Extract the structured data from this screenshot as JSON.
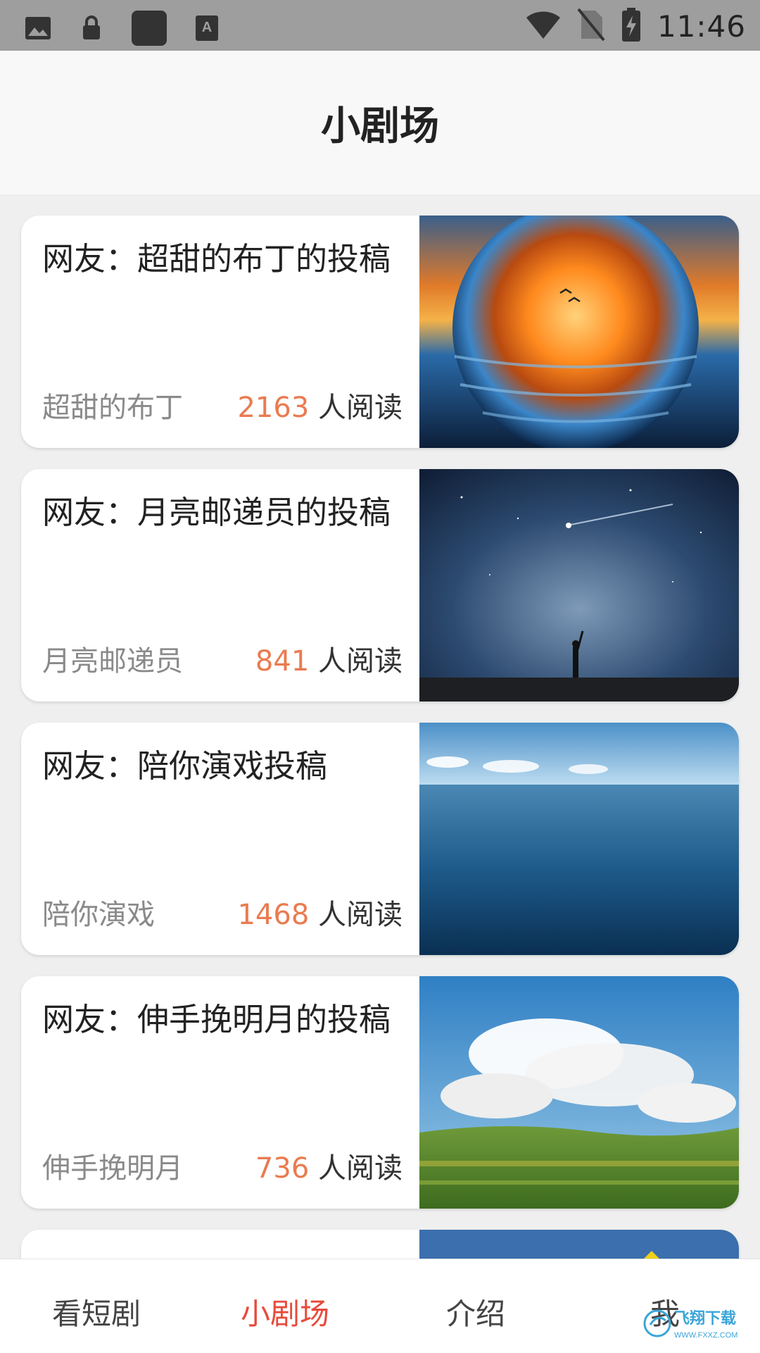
{
  "status_bar": {
    "time": "11:46",
    "left_icons": [
      "image-icon",
      "lock-icon",
      "app-icon",
      "font-icon"
    ],
    "right_icons": [
      "wifi-icon",
      "no-sim-icon",
      "battery-charging-icon"
    ]
  },
  "header": {
    "title": "小剧场"
  },
  "cards": [
    {
      "title": "网友：超甜的布丁的投稿",
      "author": "超甜的布丁",
      "reads": "2163",
      "reads_suffix": " 人阅读"
    },
    {
      "title": "网友：月亮邮递员的投稿",
      "author": "月亮邮递员",
      "reads": "841",
      "reads_suffix": " 人阅读"
    },
    {
      "title": "网友：陪你演戏投稿",
      "author": "陪你演戏",
      "reads": "1468",
      "reads_suffix": " 人阅读"
    },
    {
      "title": "网友：伸手挽明月的投稿",
      "author": "伸手挽明月",
      "reads": "736",
      "reads_suffix": " 人阅读"
    }
  ],
  "bottom_nav": [
    {
      "label": "看短剧"
    },
    {
      "label": "小剧场"
    },
    {
      "label": "介绍"
    },
    {
      "label": "我"
    }
  ],
  "watermark": {
    "text": "飞翔下载",
    "subtext": "WWW.FXXZ.COM"
  },
  "colors": {
    "accent": "#e84a3a",
    "read_count": "#ea7b50"
  }
}
